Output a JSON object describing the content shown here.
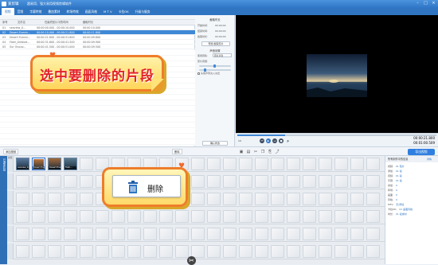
{
  "window": {
    "app_name": "爱剪辑",
    "subtitle": "超易用、强大易用视频剪辑软件",
    "controls": [
      "–",
      "□",
      "×"
    ]
  },
  "menu": {
    "items": [
      "视频",
      "音频",
      "字幕特效",
      "叠加素材",
      "转场特效",
      "画面风格",
      "M T V",
      "卡拉OK",
      "升级与服务"
    ],
    "active_index": 0
  },
  "media_list": {
    "columns": [
      "序号",
      "文件名",
      "在最终影片中的时间",
      "",
      "",
      "截取时长"
    ],
    "rows": [
      {
        "num": "01",
        "name": "seaview_0...",
        "time": "00:00:00.000 - 00:00:10.000",
        "dur": "00:00:10.000",
        "selected": false
      },
      {
        "num": "02",
        "name": "Desert Evenin...",
        "time": "00:00:10.000 - 00:00:21.800",
        "dur": "00:00:11.800",
        "selected": true
      },
      {
        "num": "03",
        "name": "Desert Evenin...",
        "time": "00:00:21.800 - 00:00:31.600",
        "dur": "00:00:09.800",
        "selected": false
      },
      {
        "num": "04",
        "name": "Fabri_Ambiod...",
        "time": "00:00:31.600 - 00:00:41.500",
        "dur": "00:00:09.900",
        "selected": false
      },
      {
        "num": "05",
        "name": "Sur Oiscov...",
        "time": "00:00:41.500 - 00:00:51.000",
        "dur": "00:00:09.500",
        "selected": false
      }
    ]
  },
  "properties": {
    "section1": "截取时长",
    "start_label": "开始时间:",
    "start_value": "00:00:00",
    "end_label": "结束时间:",
    "end_value": "00:00:00",
    "dur_label": "截取时长:",
    "dur_value": "00:00:00",
    "preview_button": "预览/截取原片",
    "section2": "声音设置",
    "voice_label": "使用音轨:",
    "voice_value": "原片声音",
    "vol_label": "原片音量:",
    "checkbox_label": "头尾声音淡入淡出",
    "confirm_button": "确认修改"
  },
  "player": {
    "time_current": "00:00:21.800",
    "time_total": "00:01:00.509",
    "speed": "1X",
    "progress_fraction": 0.24
  },
  "bottom_left": {
    "add_button": "添加视频",
    "delete_button": "删除"
  },
  "export_button": "导出视频",
  "side_tab": "已添加片段",
  "timeline": {
    "row_header": "视频",
    "clips": [
      {
        "label": "seaview_0...",
        "color": "#5a7a9e",
        "selected": false
      },
      {
        "label": "Desert Evening",
        "color": "#c77a3a",
        "selected": true
      },
      {
        "label": "Desert Evening",
        "color": "#a46a3a",
        "selected": false
      },
      {
        "label": "Fabri...",
        "color": "#5a7a8e",
        "selected": false
      }
    ]
  },
  "info_panel": {
    "title": "所有制作中的信息",
    "button": "详情",
    "items": [
      {
        "k": "视频:",
        "v": "01 短片"
      },
      {
        "k": "添加:",
        "v": "01 段"
      },
      {
        "k": "音频:",
        "v": "01 段"
      },
      {
        "k": "字幕:",
        "v": "01 段"
      },
      {
        "k": "叠加:",
        "v": "0"
      },
      {
        "k": "转场:",
        "v": "0"
      },
      {
        "k": "画面:",
        "v": "0"
      },
      {
        "k": "风格:",
        "v": "0"
      },
      {
        "k": "MTV:",
        "v": "无/添加"
      },
      {
        "k": "卡拉OK:",
        "v": "01 画面风格"
      },
      {
        "k": "时长:",
        "v": "01 段素材"
      }
    ]
  },
  "callouts": {
    "select_text": "选中要删除的片段",
    "delete_label": "删除"
  }
}
